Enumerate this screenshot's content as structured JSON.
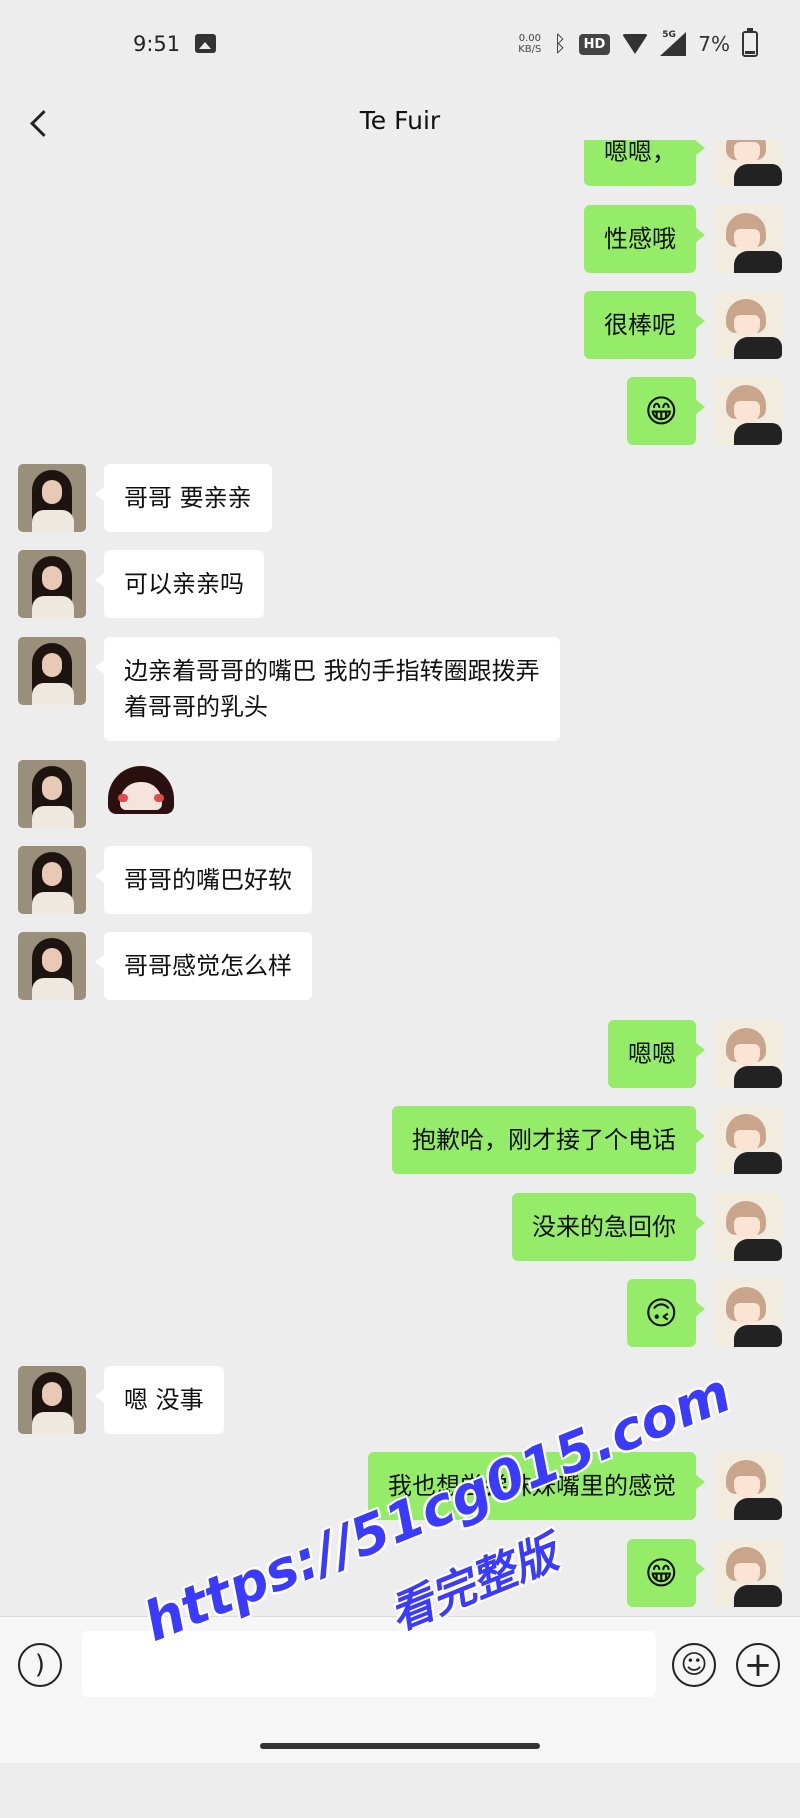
{
  "status_bar": {
    "time": "9:51",
    "net_speed_value": "0.00",
    "net_speed_unit": "KB/S",
    "hd_badge": "HD",
    "network_type": "5G",
    "battery": "7%"
  },
  "header": {
    "title": "Te Fuir"
  },
  "messages": [
    {
      "side": "out",
      "text": "嗯嗯，"
    },
    {
      "side": "out",
      "text": "性感哦"
    },
    {
      "side": "out",
      "text": "很棒呢"
    },
    {
      "side": "out",
      "emoji": "😁"
    },
    {
      "side": "in",
      "text": "哥哥 要亲亲"
    },
    {
      "side": "in",
      "text": "可以亲亲吗"
    },
    {
      "side": "in",
      "text": "边亲着哥哥的嘴巴 我的手指转圈跟拨弄\n着哥哥的乳头"
    },
    {
      "side": "in",
      "sticker": "penguin-sticker"
    },
    {
      "side": "in",
      "text": "哥哥的嘴巴好软"
    },
    {
      "side": "in",
      "text": "哥哥感觉怎么样"
    },
    {
      "side": "out",
      "text": "嗯嗯"
    },
    {
      "side": "out",
      "text": "抱歉哈，刚才接了个电话"
    },
    {
      "side": "out",
      "text": "没来的急回你"
    },
    {
      "side": "out",
      "emoji": "🙃"
    },
    {
      "side": "in",
      "text": "嗯 没事"
    },
    {
      "side": "out",
      "text": "我也想尝尝妹妹嘴里的感觉"
    },
    {
      "side": "out",
      "emoji": "😁"
    },
    {
      "side": "in",
      "image": "photo-message"
    }
  ],
  "input_bar": {
    "input_value": "",
    "voice_icon": "voice-icon",
    "emoji_icon": "emoji-icon",
    "plus_icon": "plus-icon"
  },
  "watermark": {
    "url": "https://51cg015.com",
    "caption": "看完整版"
  },
  "colors": {
    "background": "#ededed",
    "outgoing_bubble": "#95ec69",
    "incoming_bubble": "#ffffff",
    "watermark": "#3b3bff"
  }
}
